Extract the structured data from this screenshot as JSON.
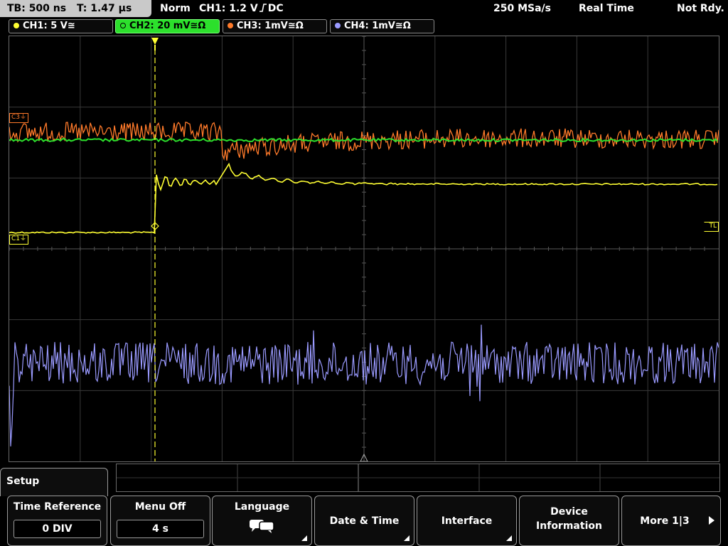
{
  "timebase": {
    "tb": "TB: 500 ns",
    "t": "T: 1.47 µs"
  },
  "status": {
    "mode": "Norm",
    "trigger": "CH1: 1.2 V",
    "coupling": "DC",
    "sample_rate": "250 MSa/s",
    "acq": "Real Time",
    "ready": "Not Rdy."
  },
  "channels": [
    {
      "label": "CH1: 5 V≅",
      "color": "#ffff33"
    },
    {
      "label": "CH2: 20 mV≅Ω",
      "color": "#2ce02c"
    },
    {
      "label": "CH3: 1mV≅Ω",
      "color": "#ff7a2a"
    },
    {
      "label": "CH4: 1mV≅Ω",
      "color": "#9a9aff"
    }
  ],
  "markers": {
    "c1": "C1",
    "c3": "C3",
    "tl": "TL"
  },
  "menu": {
    "title": "Setup",
    "softkeys": [
      {
        "label": "Time Reference",
        "value": "0 DIV"
      },
      {
        "label": "Menu Off",
        "value": "4 s"
      },
      {
        "label": "Language",
        "value": ""
      },
      {
        "label": "Date & Time",
        "value": ""
      },
      {
        "label": "Interface",
        "value": ""
      },
      {
        "label": "Device",
        "label2": "Information",
        "value": ""
      },
      {
        "label": "More 1|3",
        "value": ""
      }
    ]
  }
}
